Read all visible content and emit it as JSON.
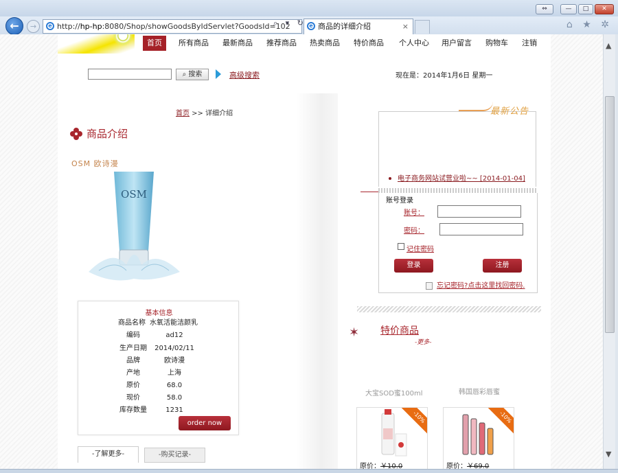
{
  "browser": {
    "url_prefix": "http://",
    "url_host": "hp-hp",
    "url_rest": ":8080/Shop/showGoodsByIdServlet?GoodsId=102",
    "tab_title": "商品的详细介绍",
    "tab_close": "×",
    "addr_tools": "⌕ ▾ ↻",
    "tools": "⌂ ★ ✲",
    "window_buttons": [
      "⇔",
      "—",
      "□",
      "✕"
    ],
    "back": "←",
    "forward": "→"
  },
  "nav": {
    "items": [
      "首页",
      "所有商品",
      "最新商品",
      "推荐商品",
      "热卖商品",
      "特价商品",
      "个人中心",
      "用户留言",
      "购物车",
      "注销"
    ],
    "active_index": 0
  },
  "search": {
    "button": "搜索",
    "advanced": "高级搜索",
    "date": "现在是：2014年1月6日 星期一"
  },
  "breadcrumb": {
    "home": "首页",
    "sep": " >> ",
    "current": "详细介绍"
  },
  "product": {
    "section_title": "商品介绍",
    "brand_logo": "OSM 欧诗漫",
    "tube_text": "OSM",
    "info_title": "基本信息",
    "fields": [
      {
        "label": "商品名称",
        "value": "水氧活能洁颜乳"
      },
      {
        "label": "编码",
        "value": "ad12"
      },
      {
        "label": "生产日期",
        "value": "2014/02/11"
      },
      {
        "label": "品牌",
        "value": "欧诗漫"
      },
      {
        "label": "产地",
        "value": "上海"
      },
      {
        "label": "原价",
        "value": "68.0"
      },
      {
        "label": "现价",
        "value": "58.0"
      },
      {
        "label": "库存数量",
        "value": "1231"
      }
    ],
    "order_button": "order now",
    "tabs": [
      "-了解更多-",
      "-购买记录-"
    ]
  },
  "notice": {
    "title": "最新公告",
    "item": "电子商务网站试营业啦~~ [2014-01-04]"
  },
  "login": {
    "title": "账号登录",
    "account_label": "账号：",
    "password_label": "密码：",
    "remember": "记住密码",
    "login_button": "登录",
    "register_button": "注册",
    "forgot": "忘记密码?点击这里找回密码."
  },
  "specials": {
    "title": "特价商品",
    "more": "-更多-",
    "items": [
      {
        "name": "大宝SOD蜜100ml",
        "badge": "-10%",
        "price_label": "原价：",
        "price": "￥10.0"
      },
      {
        "name": "韩国唇彩唇蜜",
        "badge": "-10%",
        "price_label": "原价：",
        "price": "￥69.0"
      }
    ]
  },
  "colors": {
    "brand": "#a52128",
    "notice": "#e0a041"
  }
}
